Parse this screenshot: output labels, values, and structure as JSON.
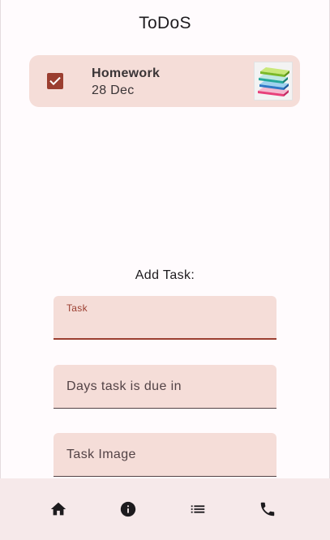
{
  "app": {
    "title": "ToDoS"
  },
  "todos": [
    {
      "title": "Homework",
      "date": "28 Dec",
      "checked": true,
      "image_icon": "books-icon"
    }
  ],
  "form": {
    "heading": "Add Task:",
    "task_label": "Task",
    "task_value": "",
    "days_placeholder": "Days task is due in",
    "image_placeholder": "Task Image"
  },
  "bottom_nav": {
    "items": [
      {
        "icon": "home-icon"
      },
      {
        "icon": "info-icon"
      },
      {
        "icon": "list-icon"
      },
      {
        "icon": "phone-icon"
      }
    ]
  },
  "colors": {
    "primary": "#9b3e30",
    "card_bg": "#f5ddd8",
    "nav_bg": "#f6e9ea",
    "page_bg": "#fffbfd"
  }
}
